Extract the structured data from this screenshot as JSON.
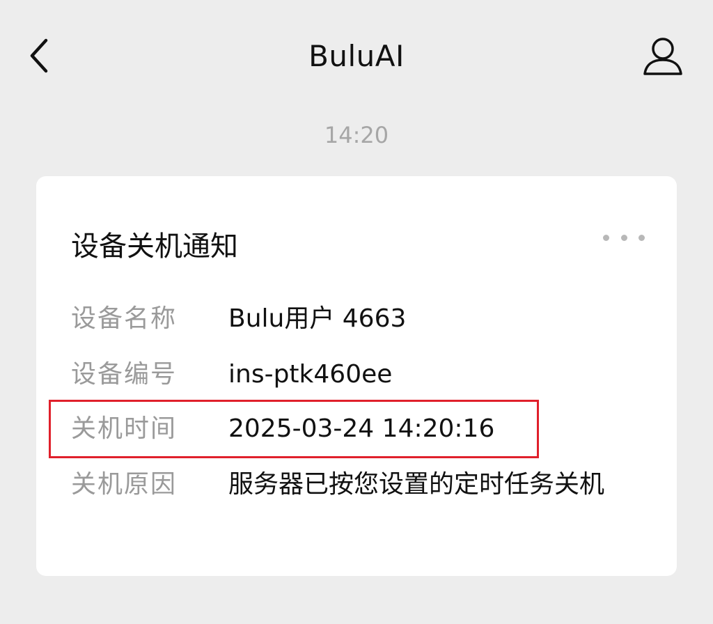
{
  "header": {
    "title": "BuluAI",
    "back_icon": "chevron-left-icon",
    "profile_icon": "user-profile-icon"
  },
  "message": {
    "time": "14:20"
  },
  "card": {
    "title": "设备关机通知",
    "more_icon": "more-dots-icon",
    "rows": [
      {
        "label": "设备名称",
        "value": "Bulu用户 4663"
      },
      {
        "label": "设备编号",
        "value": "ins-ptk460ee"
      },
      {
        "label": "关机时间",
        "value": "2025-03-24 14:20:16"
      },
      {
        "label": "关机原因",
        "value": "服务器已按您设置的定时任务关机"
      }
    ]
  },
  "colors": {
    "background": "#ededed",
    "card": "#ffffff",
    "highlight": "#e0202b",
    "label": "#9a9a9a"
  }
}
